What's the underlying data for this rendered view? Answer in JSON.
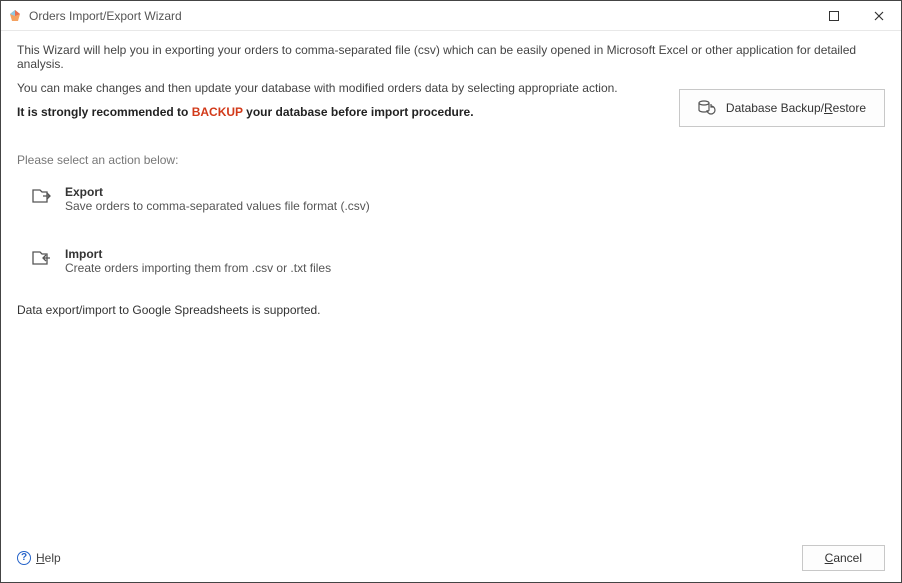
{
  "window": {
    "title": "Orders Import/Export Wizard"
  },
  "intro": {
    "line1": "This Wizard will help you in exporting your orders to comma-separated file (csv) which can be easily opened in Microsoft Excel or other application for detailed analysis.",
    "line2": "You can make changes and then update your database with modified orders data by selecting appropriate action.",
    "strong_pre": "It is strongly recommended to ",
    "strong_backup": "BACKUP",
    "strong_post": " your database before import procedure."
  },
  "backup_button": {
    "label_pre": "Database Backup/",
    "label_u": "R",
    "label_post": "estore"
  },
  "section_label": "Please select an action below:",
  "actions": {
    "export": {
      "title": "Export",
      "desc": "Save orders to comma-separated values file format (.csv)"
    },
    "import": {
      "title": "Import",
      "desc": "Create orders importing them from .csv or .txt files"
    }
  },
  "support_note": "Data export/import to Google Spreadsheets is supported.",
  "footer": {
    "help_u": "H",
    "help_rest": "elp",
    "cancel_u": "C",
    "cancel_rest": "ancel"
  }
}
